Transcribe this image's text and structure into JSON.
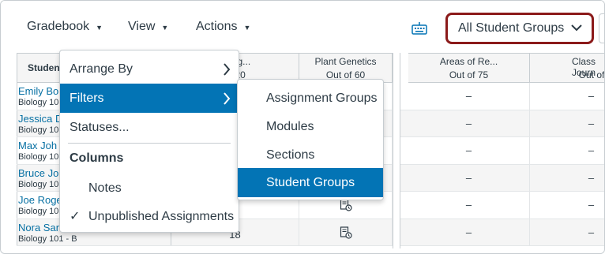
{
  "toolbar": {
    "gradebook_label": "Gradebook",
    "view_label": "View",
    "actions_label": "Actions",
    "group_filter_value": "All Student Groups"
  },
  "grid": {
    "student_header": "Student",
    "columns": [
      {
        "title": "Assig...",
        "points": "of 20"
      },
      {
        "title": "Plant Genetics",
        "points": "Out of 60"
      },
      {
        "title": "Areas of Re...",
        "points": "Out of 75"
      },
      {
        "title": "Class Journ",
        "points": "Out of"
      }
    ],
    "rows": [
      {
        "name": "Emily Bo",
        "section": "Biology 10",
        "c1": "",
        "c2": "",
        "c3": "–",
        "c4": "–"
      },
      {
        "name": "Jessica D",
        "section": "Biology 10",
        "c1": "",
        "c2": "",
        "c3": "–",
        "c4": "–"
      },
      {
        "name": "Max Joh",
        "section": "Biology 10",
        "c1": "",
        "c2": "",
        "c3": "–",
        "c4": "–"
      },
      {
        "name": "Bruce Jo",
        "section": "Biology 10",
        "c1": "",
        "c2": "",
        "c3": "–",
        "c4": "–"
      },
      {
        "name": "Joe Roge",
        "section": "Biology 10",
        "c1": "",
        "c2": "",
        "c3": "–",
        "c4": "–"
      },
      {
        "name": "Nora Sanderson",
        "section": "Biology 101 - B",
        "c1": "18",
        "c2": "",
        "c3": "–",
        "c4": "–"
      }
    ]
  },
  "view_menu": {
    "arrange_by": "Arrange By",
    "filters": "Filters",
    "statuses": "Statuses...",
    "columns_heading": "Columns",
    "notes": "Notes",
    "unpublished": "Unpublished Assignments",
    "check_glyph": "✓"
  },
  "filters_submenu": {
    "items": [
      "Assignment Groups",
      "Modules",
      "Sections",
      "Student Groups"
    ]
  },
  "colors": {
    "accent": "#0374b5",
    "highlight_border": "#8b1a1a",
    "link": "#0770a3"
  }
}
